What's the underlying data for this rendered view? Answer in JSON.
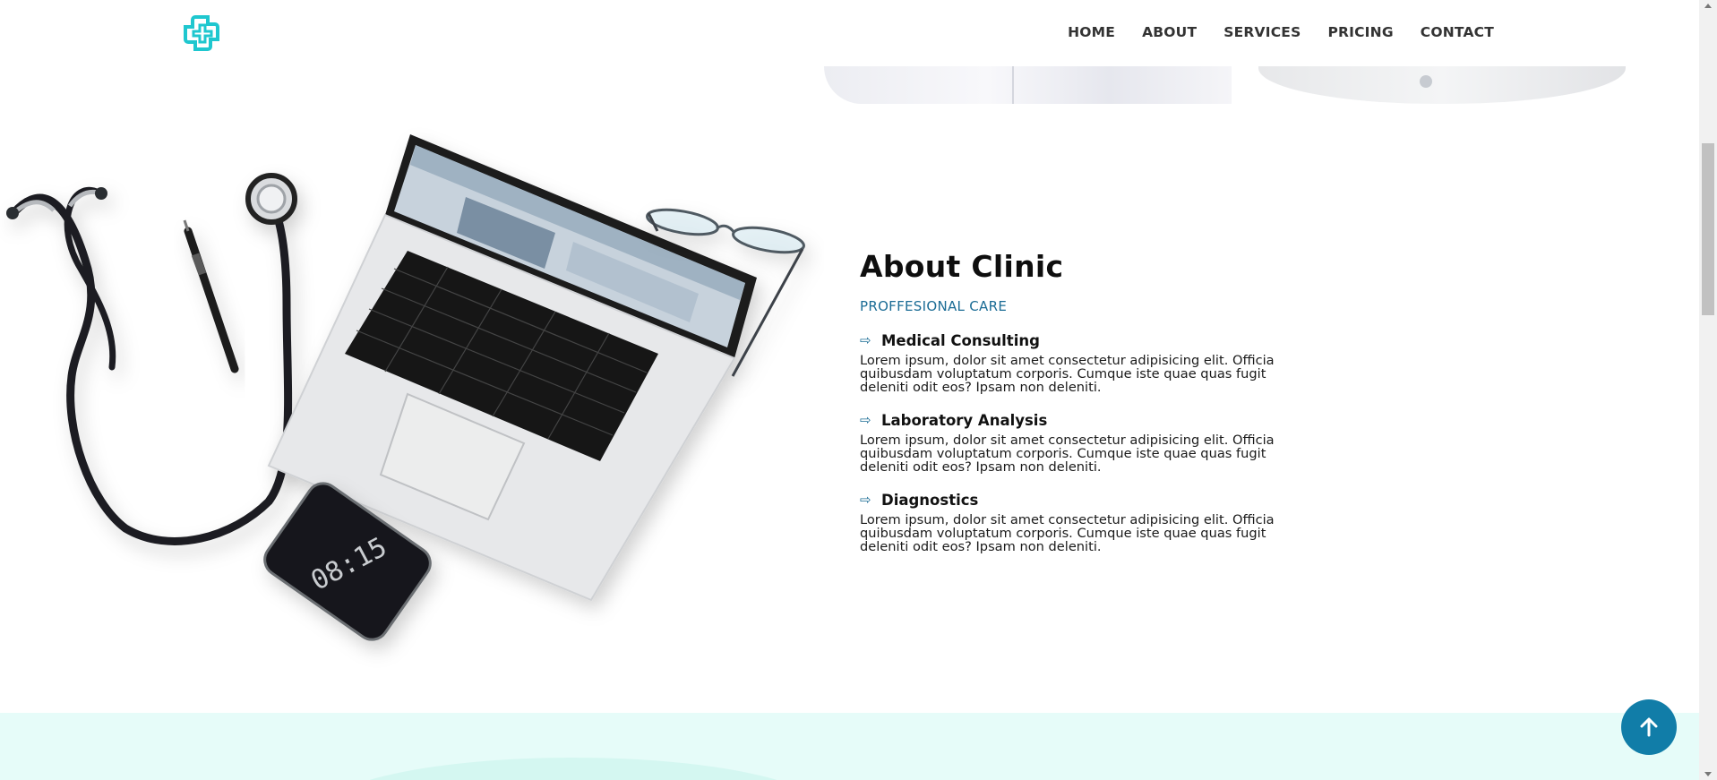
{
  "header": {
    "logo_icon": "medical-cross-logo-icon",
    "nav": [
      {
        "label": "HOME"
      },
      {
        "label": "ABOUT"
      },
      {
        "label": "SERVICES"
      },
      {
        "label": "PRICING"
      },
      {
        "label": "CONTACT"
      }
    ]
  },
  "about": {
    "title": "About Clinic",
    "subtitle": "PROFFESIONAL CARE",
    "features": [
      {
        "icon": "arrow-right-icon",
        "title": "Medical Consulting",
        "description": "Lorem ipsum, dolor sit amet consectetur adipisicing elit. Officia quibusdam voluptatum corporis. Cumque iste quae quas fugit deleniti odit eos? Ipsam non deleniti."
      },
      {
        "icon": "arrow-right-icon",
        "title": "Laboratory Analysis",
        "description": "Lorem ipsum, dolor sit amet consectetur adipisicing elit. Officia quibusdam voluptatum corporis. Cumque iste quae quas fugit deleniti odit eos? Ipsam non deleniti."
      },
      {
        "icon": "arrow-right-icon",
        "title": "Diagnostics",
        "description": "Lorem ipsum, dolor sit amet consectetur adipisicing elit. Officia quibusdam voluptatum corporis. Cumque iste quae quas fugit deleniti odit eos? Ipsam non deleniti."
      }
    ]
  },
  "illustration": {
    "phone_time": "08:15"
  },
  "scroll_to_top": {
    "icon": "arrow-up-icon"
  },
  "colors": {
    "accent": "#117da8",
    "logo": "#1fc7cf",
    "band": "#e6fcf9"
  }
}
